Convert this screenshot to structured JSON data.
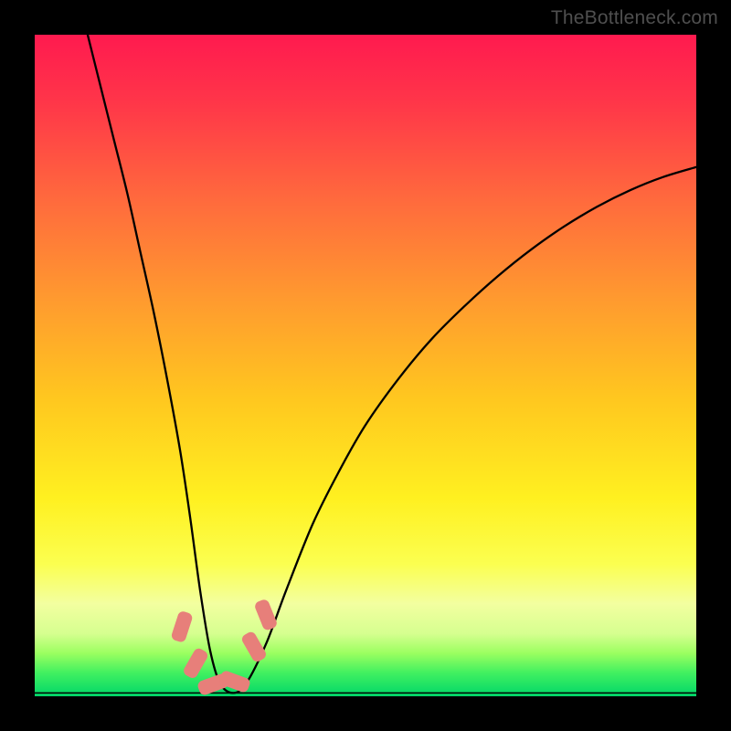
{
  "attribution": "TheBottleneck.com",
  "colors": {
    "frame": "#000000",
    "attribution": "#4f4f4f",
    "curve": "#000000",
    "marker": "#e77f7a",
    "gradient_stops": [
      {
        "offset": 0.0,
        "color": "#ff1a4f"
      },
      {
        "offset": 0.1,
        "color": "#ff3549"
      },
      {
        "offset": 0.25,
        "color": "#ff6a3d"
      },
      {
        "offset": 0.4,
        "color": "#ff9a2f"
      },
      {
        "offset": 0.55,
        "color": "#ffc71f"
      },
      {
        "offset": 0.7,
        "color": "#fff020"
      },
      {
        "offset": 0.8,
        "color": "#fbff50"
      },
      {
        "offset": 0.86,
        "color": "#f3ffa0"
      },
      {
        "offset": 0.905,
        "color": "#d6ff90"
      },
      {
        "offset": 0.935,
        "color": "#9bff60"
      },
      {
        "offset": 0.965,
        "color": "#40f060"
      },
      {
        "offset": 1.0,
        "color": "#00d769"
      }
    ]
  },
  "chart_data": {
    "type": "line",
    "title": "",
    "xlabel": "",
    "ylabel": "",
    "xlim": [
      0,
      100
    ],
    "ylim": [
      0,
      100
    ],
    "grid": false,
    "legend": false,
    "series": [
      {
        "name": "bottleneck-curve",
        "x": [
          8,
          10,
          12,
          14,
          16,
          18,
          20,
          22,
          23.5,
          25,
          26.5,
          28,
          30,
          32,
          35,
          38,
          42,
          46,
          50,
          55,
          60,
          65,
          70,
          75,
          80,
          85,
          90,
          95,
          100
        ],
        "y": [
          100,
          92,
          84,
          76,
          67,
          58,
          48,
          37,
          27,
          16,
          7,
          2,
          0.5,
          2,
          8,
          16,
          26,
          34,
          41,
          48,
          54,
          59,
          63.5,
          67.5,
          71,
          74,
          76.5,
          78.5,
          80
        ]
      }
    ],
    "markers": [
      {
        "x": 22.3,
        "y": 10.5,
        "w": 2.2,
        "h": 4.6,
        "rot": 18
      },
      {
        "x": 24.3,
        "y": 5.0,
        "w": 2.2,
        "h": 4.6,
        "rot": 30
      },
      {
        "x": 27.0,
        "y": 1.8,
        "w": 2.2,
        "h": 4.6,
        "rot": 70
      },
      {
        "x": 30.3,
        "y": 2.2,
        "w": 2.2,
        "h": 4.6,
        "rot": -70
      },
      {
        "x": 33.2,
        "y": 7.5,
        "w": 2.2,
        "h": 4.6,
        "rot": -30
      },
      {
        "x": 35.0,
        "y": 12.3,
        "w": 2.2,
        "h": 4.6,
        "rot": -22
      }
    ],
    "baseline_y": 0.5
  }
}
